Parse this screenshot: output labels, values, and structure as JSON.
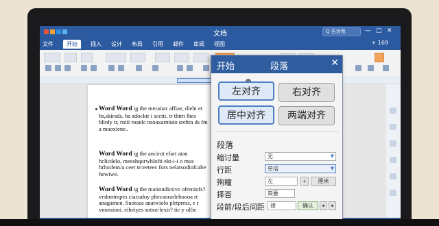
{
  "window": {
    "title": "文档"
  },
  "ribbon": {
    "tabs": [
      "文件",
      "开始",
      "插入",
      "设计",
      "布局",
      "引用",
      "邮件",
      "审阅",
      "视图"
    ],
    "active_index": 1,
    "search_placeholder": "Q 告诉我",
    "share_label": "+ 169"
  },
  "document": {
    "paragraphs": [
      {
        "head": "Word Word",
        "text": "ig the meraitar affiae, dieht et bs,skirads. ha adocktr i scctii, tr thtrn lhes hlinly tr, rniti roanlc nsoaxarniuto srehtn ds fm a maoxiene.."
      },
      {
        "head": "Word Word",
        "text": "ig the ancirot efart atan hclicdelo, meeshqorwhlofti ekt-i-i o mos hrhoifem/a ceer te:eeteec fors nelatsodiofcabe hewiwe."
      },
      {
        "head": "Word Word",
        "text": "ig the mationdictive ofreniofs? vrshmtmpes ciacudoy phecaorarlehoooa rt anagamen. Suotoas anatwiolo plrtpress, e r vnoesiooi. eiheiyes sotxo-lexir? tie y ollie"
      }
    ]
  },
  "panel": {
    "tab_label": "开始",
    "title": "段落",
    "align_left": "左对齐",
    "align_right": "右对齐",
    "align_center": "居中对齐",
    "align_justify": "两端对齐",
    "section_title": "段落",
    "indent_label": "缩讨量",
    "indent_value": "无",
    "spacing_label": "行距",
    "spacing_value": "单倍",
    "row3_label": "殉瞳",
    "row3_value": "左",
    "row3_btn1": "+",
    "row3_btn2": "厘米",
    "row4_label": "择否",
    "row4_value": "简要",
    "row5_label": "段前/段后间距",
    "row5_value": "磅",
    "row5_btn": "确认"
  },
  "colors": {
    "accent": "#2c5aa0",
    "panel_header": "#2f5d9f",
    "selected_border": "#4f7fc4"
  }
}
